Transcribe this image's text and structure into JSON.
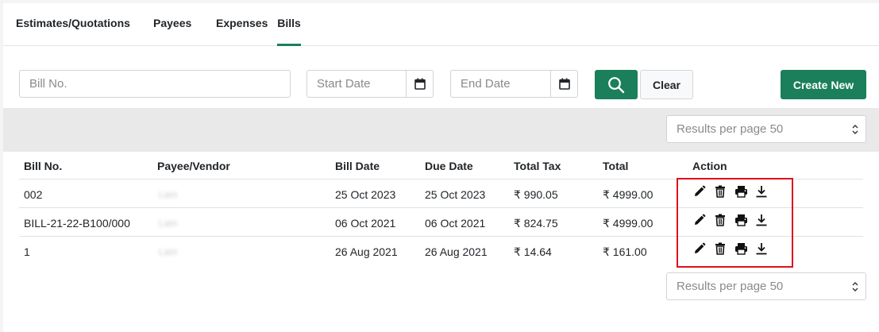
{
  "tabs": [
    {
      "label": "Estimates/Quotations"
    },
    {
      "label": "Payees"
    },
    {
      "label": "Expenses"
    },
    {
      "label": "Bills"
    }
  ],
  "filters": {
    "bill_no_placeholder": "Bill No.",
    "start_date_placeholder": "Start Date",
    "end_date_placeholder": "End Date",
    "clear_label": "Clear",
    "create_new_label": "Create New"
  },
  "pagination": {
    "top_label": "Results per page 50",
    "bottom_label": "Results per page 50"
  },
  "table": {
    "headers": [
      "Bill No.",
      "Payee/Vendor",
      "Bill Date",
      "Due Date",
      "Total Tax",
      "Total",
      "Action"
    ],
    "rows": [
      {
        "bill_no": "002",
        "payee": "Lam",
        "bill_date": "25 Oct 2023",
        "due_date": "25 Oct 2023",
        "total_tax": "₹ 990.05",
        "total": "₹ 4999.00"
      },
      {
        "bill_no": "BILL-21-22-B100/000",
        "payee": "Lam",
        "bill_date": "06 Oct 2021",
        "due_date": "06 Oct 2021",
        "total_tax": "₹ 824.75",
        "total": "₹ 4999.00"
      },
      {
        "bill_no": "1",
        "payee": "Lam",
        "bill_date": "26 Aug 2021",
        "due_date": "26 Aug 2021",
        "total_tax": "₹ 14.64",
        "total": "₹ 161.00"
      }
    ],
    "action_icons": [
      "pencil-icon",
      "trash-icon",
      "printer-icon",
      "download-icon"
    ]
  },
  "colors": {
    "accent": "#1a7f5a",
    "highlight": "#e0101a"
  }
}
